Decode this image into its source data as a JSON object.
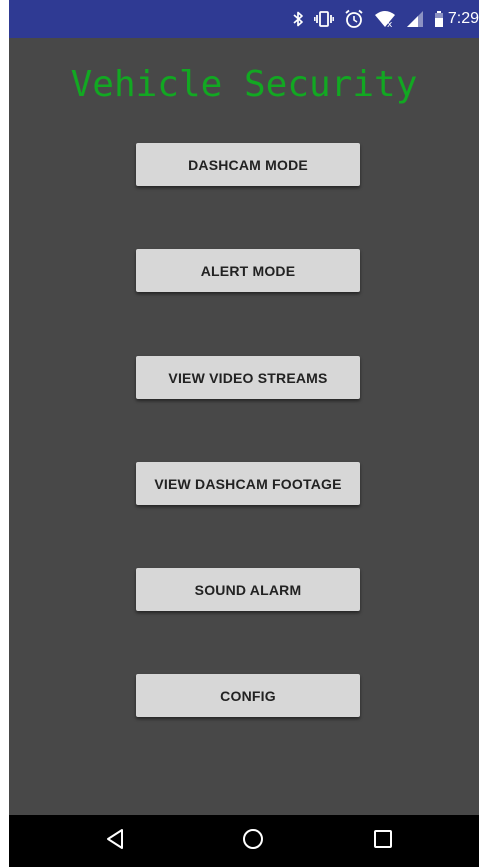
{
  "status_bar": {
    "time": "7:29",
    "icons": [
      "bluetooth-icon",
      "vibrate-icon",
      "alarm-icon",
      "wifi-icon",
      "signal-icon",
      "battery-icon"
    ],
    "background": "#2f3a93"
  },
  "app": {
    "title": "Vehicle Security",
    "title_color": "#12a822",
    "background": "#484848"
  },
  "menu": {
    "dashcam_mode": "DASHCAM MODE",
    "alert_mode": "ALERT MODE",
    "view_video_streams": "VIEW VIDEO STREAMS",
    "view_dashcam_footage": "VIEW DASHCAM FOOTAGE",
    "sound_alarm": "SOUND ALARM",
    "config": "CONFIG"
  },
  "nav_bar": {
    "icons": [
      "back-icon",
      "home-icon",
      "recents-icon"
    ]
  }
}
